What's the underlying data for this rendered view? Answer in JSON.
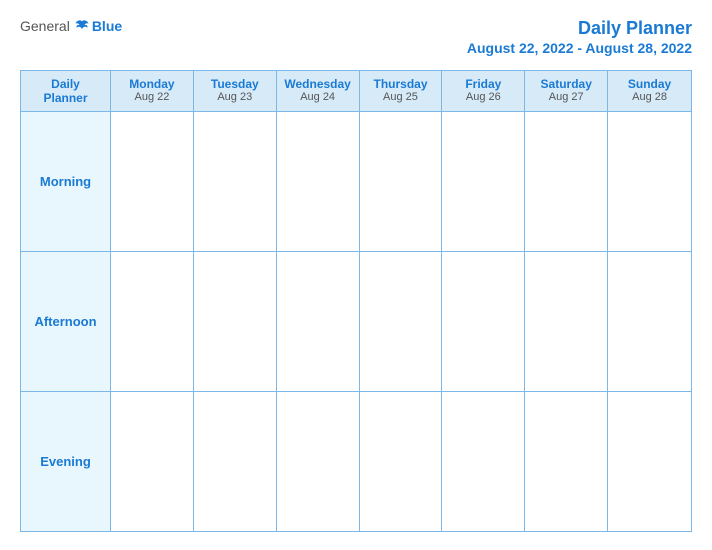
{
  "header": {
    "logo_general": "General",
    "logo_blue": "Blue",
    "title": "Daily Planner",
    "date_range": "August 22, 2022 - August 28, 2022"
  },
  "columns": [
    {
      "day": "Daily\nPlanner",
      "date": ""
    },
    {
      "day": "Monday",
      "date": "Aug 22"
    },
    {
      "day": "Tuesday",
      "date": "Aug 23"
    },
    {
      "day": "Wednesday",
      "date": "Aug 24"
    },
    {
      "day": "Thursday",
      "date": "Aug 25"
    },
    {
      "day": "Friday",
      "date": "Aug 26"
    },
    {
      "day": "Saturday",
      "date": "Aug 27"
    },
    {
      "day": "Sunday",
      "date": "Aug 28"
    }
  ],
  "rows": [
    {
      "label": "Morning"
    },
    {
      "label": "Afternoon"
    },
    {
      "label": "Evening"
    }
  ]
}
